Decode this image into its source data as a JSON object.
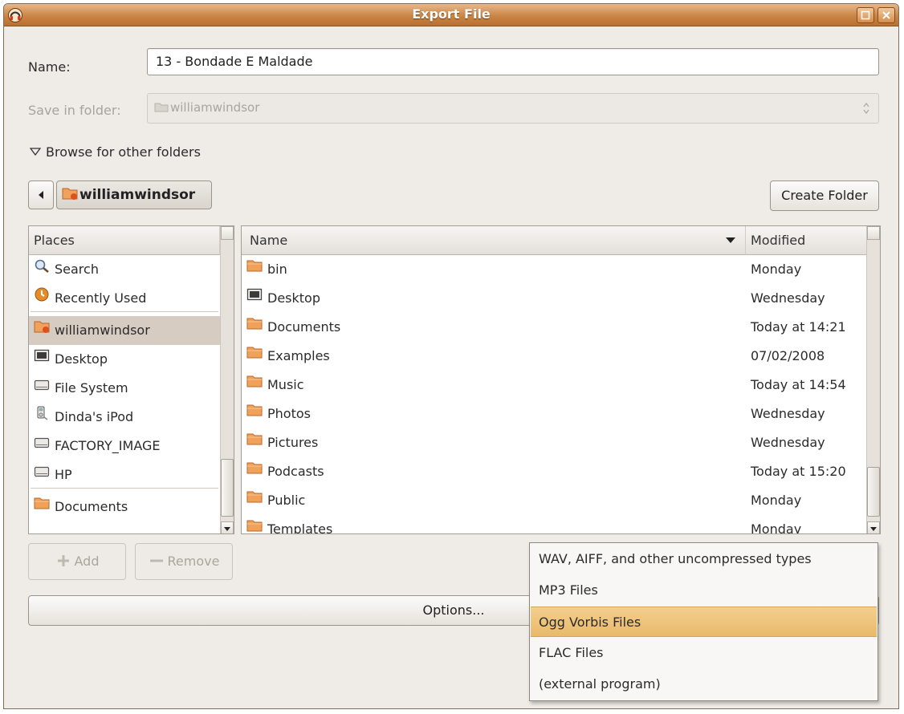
{
  "window": {
    "title": "Export File"
  },
  "name_label": "Name:",
  "name_value": "13 - Bondade E Maldade",
  "save_in_label": "Save in folder:",
  "save_in_value": "williamwindsor",
  "browse_label": "Browse for other folders",
  "path_button": "williamwindsor",
  "create_folder": "Create Folder",
  "places": {
    "header": "Places",
    "items": [
      {
        "label": "Search",
        "icon": "search-icon"
      },
      {
        "label": "Recently Used",
        "icon": "recent-icon"
      },
      {
        "label": "williamwindsor",
        "icon": "home-folder-icon"
      },
      {
        "label": "Desktop",
        "icon": "desktop-icon"
      },
      {
        "label": "File System",
        "icon": "drive-icon"
      },
      {
        "label": "Dinda's iPod",
        "icon": "ipod-icon"
      },
      {
        "label": "FACTORY_IMAGE",
        "icon": "drive-icon"
      },
      {
        "label": "HP",
        "icon": "drive-icon"
      },
      {
        "label": "Documents",
        "icon": "folder-icon"
      }
    ]
  },
  "files": {
    "col_name": "Name",
    "col_modified": "Modified",
    "rows": [
      {
        "name": "bin",
        "modified": "Monday",
        "icon": "folder-icon"
      },
      {
        "name": "Desktop",
        "modified": "Wednesday",
        "icon": "desktop-icon"
      },
      {
        "name": "Documents",
        "modified": "Today at 14:21",
        "icon": "folder-icon"
      },
      {
        "name": "Examples",
        "modified": "07/02/2008",
        "icon": "folder-icon"
      },
      {
        "name": "Music",
        "modified": "Today at 14:54",
        "icon": "folder-icon"
      },
      {
        "name": "Photos",
        "modified": "Wednesday",
        "icon": "folder-icon"
      },
      {
        "name": "Pictures",
        "modified": "Wednesday",
        "icon": "folder-icon"
      },
      {
        "name": "Podcasts",
        "modified": "Today at 15:20",
        "icon": "folder-icon"
      },
      {
        "name": "Public",
        "modified": "Monday",
        "icon": "folder-icon"
      },
      {
        "name": "Templates",
        "modified": "Monday",
        "icon": "folder-icon"
      }
    ]
  },
  "add_button": "Add",
  "remove_button": "Remove",
  "options_button": "Options...",
  "format_menu": {
    "items": [
      "WAV, AIFF, and other uncompressed types",
      "MP3 Files",
      "Ogg Vorbis Files",
      "FLAC Files",
      "(external program)"
    ],
    "selected": "Ogg Vorbis Files"
  },
  "colors": {
    "titlebar": "#c98545",
    "selection": "#d6ccc2",
    "menu_highlight": "#efc47e"
  }
}
